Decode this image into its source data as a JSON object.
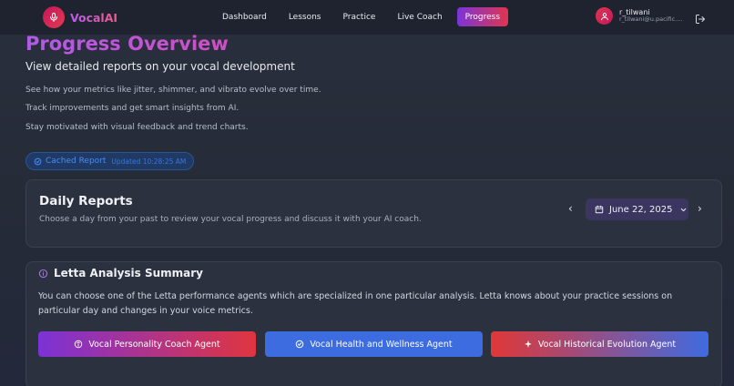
{
  "app": {
    "name": "VocalAI"
  },
  "nav": {
    "links": [
      {
        "label": "Dashboard"
      },
      {
        "label": "Lessons"
      },
      {
        "label": "Practice"
      },
      {
        "label": "Live Coach"
      },
      {
        "label": "Progress"
      }
    ],
    "active": "Progress"
  },
  "user": {
    "name": "r_tilwani",
    "email": "r_tilwani@u.pacific...."
  },
  "header": {
    "title": "Progress Overview",
    "subtitle": "View detailed reports on your vocal development",
    "lines": [
      "See how your metrics like jitter, shimmer, and vibrato evolve over time.",
      "Track improvements and get smart insights from AI.",
      "Stay motivated with visual feedback and trend charts."
    ]
  },
  "cache": {
    "label": "Cached Report",
    "updated": "Updated 10:28:25 AM"
  },
  "daily": {
    "title": "Daily Reports",
    "subtitle": "Choose a day from your past to review your vocal progress and discuss it with your AI coach.",
    "date": "June 22, 2025"
  },
  "letta": {
    "title": "Letta Analysis Summary",
    "body": "You can choose one of the Letta performance agents which are specialized in one particular analysis. Letta knows about your practice sessions on particular day and changes in your voice metrics.",
    "agents": [
      {
        "label": "Vocal Personality Coach Agent",
        "icon": "brain-icon"
      },
      {
        "label": "Vocal Health and Wellness Agent",
        "icon": "check-circle-icon"
      },
      {
        "label": "Vocal Historical Evolution Agent",
        "icon": "sparkle-icon"
      }
    ]
  },
  "colors": {
    "accent_purple": "#7c32d6",
    "accent_red": "#e0353f",
    "accent_blue": "#3d6ce0"
  }
}
